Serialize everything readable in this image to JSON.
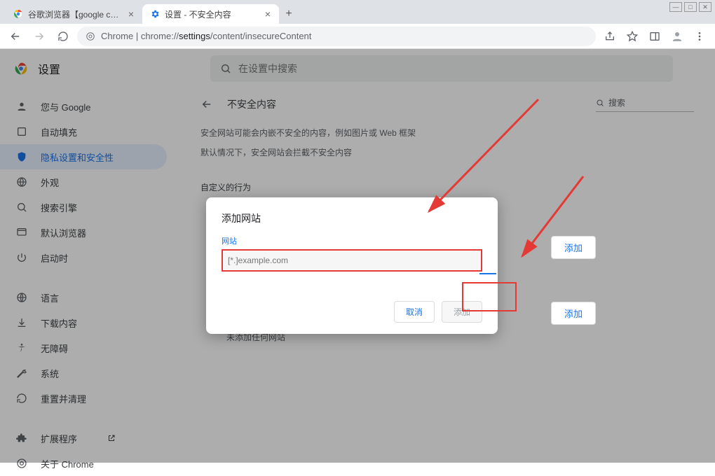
{
  "tabs": {
    "t0": {
      "title": "谷歌浏览器【google chrome】"
    },
    "t1": {
      "title": "设置 - 不安全内容"
    }
  },
  "url": {
    "pre": "Chrome",
    "sep": " | ",
    "scheme": "chrome://",
    "bold": "settings",
    "rest": "/content/insecureContent"
  },
  "header": {
    "title": "设置",
    "search_placeholder": "在设置中搜索"
  },
  "sidebar": {
    "s0": {
      "label": "您与 Google"
    },
    "s1": {
      "label": "自动填充"
    },
    "s2": {
      "label": "隐私设置和安全性"
    },
    "s3": {
      "label": "外观"
    },
    "s4": {
      "label": "搜索引擎"
    },
    "s5": {
      "label": "默认浏览器"
    },
    "s6": {
      "label": "启动时"
    },
    "s7": {
      "label": "语言"
    },
    "s8": {
      "label": "下载内容"
    },
    "s9": {
      "label": "无障碍"
    },
    "s10": {
      "label": "系统"
    },
    "s11": {
      "label": "重置并清理"
    },
    "s12": {
      "label": "扩展程序"
    },
    "s13": {
      "label": "关于 Chrome"
    }
  },
  "content": {
    "title": "不安全内容",
    "search_label": "搜索",
    "line1": "安全网站可能会内嵌不安全的内容，例如图片或 Web 框架",
    "line2": "默认情况下，安全网站会拦截不安全内容",
    "custom_label": "自定义的行为",
    "add_btn": "添加",
    "not_added": "未添加任何网站"
  },
  "dialog": {
    "title": "添加网站",
    "field_label": "网站",
    "placeholder": "[*.]example.com",
    "cancel": "取消",
    "confirm": "添加"
  }
}
